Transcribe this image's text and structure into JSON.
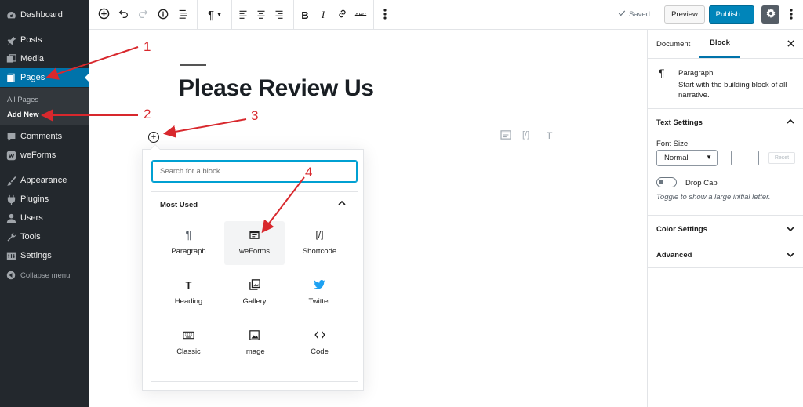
{
  "admin_menu": {
    "items": [
      {
        "label": "Dashboard",
        "icon": "dashboard-icon"
      },
      {
        "label": "Posts",
        "icon": "pin-icon"
      },
      {
        "label": "Media",
        "icon": "media-icon"
      },
      {
        "label": "Pages",
        "icon": "pages-icon",
        "active": true
      },
      {
        "label": "Comments",
        "icon": "comments-icon"
      },
      {
        "label": "weForms",
        "icon": "weforms-icon"
      },
      {
        "label": "Appearance",
        "icon": "brush-icon"
      },
      {
        "label": "Plugins",
        "icon": "plugin-icon"
      },
      {
        "label": "Users",
        "icon": "users-icon"
      },
      {
        "label": "Tools",
        "icon": "wrench-icon"
      },
      {
        "label": "Settings",
        "icon": "settings-icon"
      }
    ],
    "submenu": [
      "All Pages",
      "Add New"
    ],
    "collapse_label": "Collapse menu"
  },
  "toolbar": {
    "saved_label": "Saved",
    "preview_label": "Preview",
    "publish_label": "Publish…"
  },
  "editor": {
    "title": "Please Review Us"
  },
  "inserter": {
    "search_placeholder": "Search for a block",
    "section_title": "Most Used",
    "blocks": [
      {
        "label": "Paragraph",
        "icon": "paragraph-icon"
      },
      {
        "label": "weForms",
        "icon": "form-icon"
      },
      {
        "label": "Shortcode",
        "icon": "shortcode-icon"
      },
      {
        "label": "Heading",
        "icon": "heading-icon"
      },
      {
        "label": "Gallery",
        "icon": "gallery-icon"
      },
      {
        "label": "Twitter",
        "icon": "twitter-icon"
      },
      {
        "label": "Classic",
        "icon": "keyboard-icon"
      },
      {
        "label": "Image",
        "icon": "image-icon"
      },
      {
        "label": "Code",
        "icon": "code-icon"
      }
    ]
  },
  "settings": {
    "tabs": [
      "Document",
      "Block"
    ],
    "block_name": "Paragraph",
    "block_description": "Start with the building block of all narrative.",
    "text_settings_title": "Text Settings",
    "font_size_label": "Font Size",
    "font_size_value": "Normal",
    "reset_label": "Reset",
    "drop_cap_label": "Drop Cap",
    "drop_cap_help": "Toggle to show a large initial letter.",
    "color_settings_title": "Color Settings",
    "advanced_title": "Advanced"
  },
  "annotations": [
    "1",
    "2",
    "3",
    "4"
  ],
  "colors": {
    "admin_bg": "#23282d",
    "active_blue": "#0073aa",
    "publish_blue": "#0085ba",
    "annotation_red": "#d8282d",
    "twitter_blue": "#1da1f2"
  }
}
